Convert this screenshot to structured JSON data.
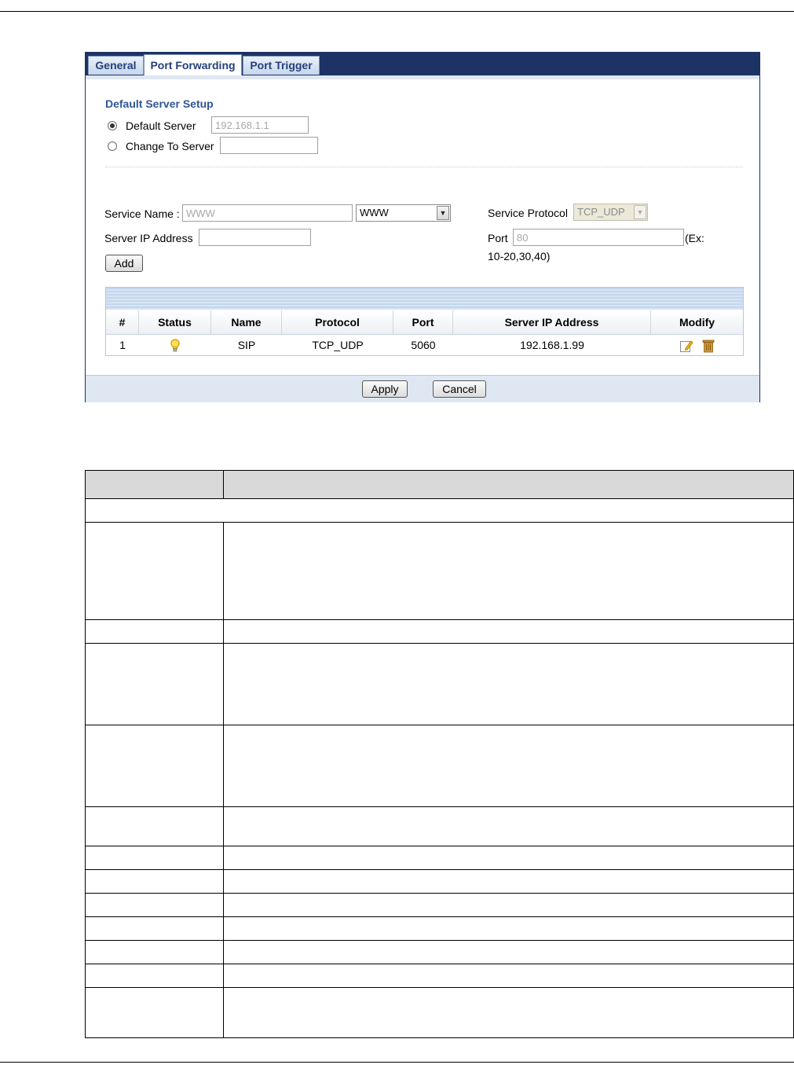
{
  "tabs": [
    {
      "label": "General",
      "active": false
    },
    {
      "label": "Port Forwarding",
      "active": true
    },
    {
      "label": "Port Trigger",
      "active": false
    }
  ],
  "default_server_setup": {
    "title": "Default Server Setup",
    "default_server_label": "Default Server",
    "default_server_value": "192.168.1.1",
    "change_to_server_label": "Change To Server",
    "change_to_server_value": "",
    "selected": "default_server"
  },
  "service_form": {
    "service_name_label": "Service Name :",
    "service_name_placeholder": "WWW",
    "service_select_value": "WWW",
    "service_protocol_label": "Service Protocol",
    "service_protocol_value": "TCP_UDP",
    "server_ip_label": "Server IP Address",
    "server_ip_value": "",
    "port_label": "Port",
    "port_placeholder": "80",
    "port_hint_a": "(Ex:",
    "port_hint_b": "10-20,30,40)",
    "add_button": "Add"
  },
  "rules_table": {
    "columns": [
      "#",
      "Status",
      "Name",
      "Protocol",
      "Port",
      "Server IP Address",
      "Modify"
    ],
    "rows": [
      {
        "index": "1",
        "status_icon": "lightbulb-icon",
        "name": "SIP",
        "protocol": "TCP_UDP",
        "port": "5060",
        "server_ip": "192.168.1.99",
        "modify_icons": [
          "edit-icon",
          "trash-icon"
        ]
      }
    ]
  },
  "footer": {
    "apply_button": "Apply",
    "cancel_button": "Cancel"
  },
  "colors": {
    "tab_bar": "#1d3366",
    "accent_title": "#2f5597",
    "panel_band": "#dfe7f3",
    "table_header_gray": "#d9d9d9"
  }
}
